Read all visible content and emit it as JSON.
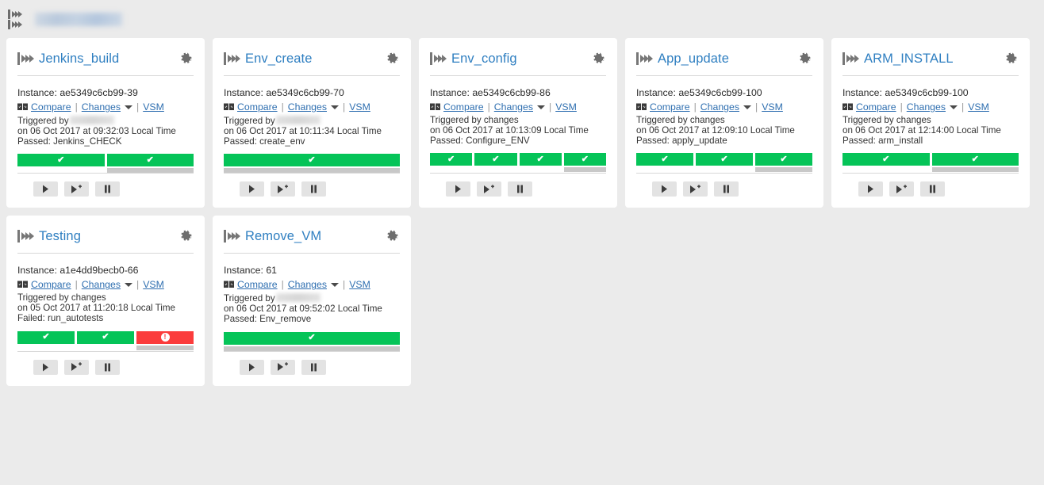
{
  "topbar": {
    "logo_icon": "pipeline-logo-icon",
    "title_redacted": "XXXXXXXXXXXX"
  },
  "labels": {
    "instance_prefix": "Instance: ",
    "compare": "Compare",
    "changes": "Changes",
    "vsm": "VSM",
    "separator": "|",
    "play_icon": "play-icon",
    "play_with_options_icon": "play-with-options-icon",
    "pause_icon": "pause-icon",
    "gear_icon": "gear-icon",
    "compare_icon": "compare-icon",
    "pipeline_icon": "pipeline-icon",
    "caret_icon": "chevron-down-icon",
    "pass_icon": "check-icon",
    "fail_icon": "alert-icon"
  },
  "colors": {
    "pass": "#05c458",
    "fail": "#fb3c3c",
    "idle": "#c8c8c8",
    "link": "#2f6fb0",
    "title": "#2f7fc1",
    "page_bg": "#ebebeb",
    "card_bg": "#ffffff"
  },
  "pipelines": [
    {
      "name": "Jenkins_build",
      "instance": "Instance: ae5349c6cb99-39",
      "trigger_line1_prefix": "Triggered by",
      "trigger_redacted": "XXXXXXX",
      "trigger_line2": "on 06 Oct 2017 at 09:32:03 Local Time",
      "status_line": "Passed: Jenkins_CHECK",
      "result": "Passed",
      "stages": [
        {
          "status": "pass",
          "sub": false
        },
        {
          "status": "pass",
          "sub": true
        }
      ]
    },
    {
      "name": "Env_create",
      "instance": "Instance: ae5349c6cb99-70",
      "trigger_line1_prefix": "Triggered by",
      "trigger_redacted": "XXXXXXX",
      "trigger_line2": "on 06 Oct 2017 at 10:11:34 Local Time",
      "status_line": "Passed: create_env",
      "result": "Passed",
      "stages": [
        {
          "status": "pass",
          "sub": true
        }
      ]
    },
    {
      "name": "Env_config",
      "instance": "Instance: ae5349c6cb99-86",
      "trigger_line1_prefix": "Triggered by changes",
      "trigger_redacted": "",
      "trigger_line2": "on 06 Oct 2017 at 10:13:09 Local Time",
      "status_line": "Passed: Configure_ENV",
      "result": "Passed",
      "stages": [
        {
          "status": "pass",
          "sub": false
        },
        {
          "status": "pass",
          "sub": false
        },
        {
          "status": "pass",
          "sub": false
        },
        {
          "status": "pass",
          "sub": true
        }
      ]
    },
    {
      "name": "App_update",
      "instance": "Instance: ae5349c6cb99-100",
      "trigger_line1_prefix": "Triggered by changes",
      "trigger_redacted": "",
      "trigger_line2": "on 06 Oct 2017 at 12:09:10 Local Time",
      "status_line": "Passed: apply_update",
      "result": "Passed",
      "stages": [
        {
          "status": "pass",
          "sub": false
        },
        {
          "status": "pass",
          "sub": false
        },
        {
          "status": "pass",
          "sub": true
        }
      ]
    },
    {
      "name": "ARM_INSTALL",
      "instance": "Instance: ae5349c6cb99-100",
      "trigger_line1_prefix": "Triggered by changes",
      "trigger_redacted": "",
      "trigger_line2": "on 06 Oct 2017 at 12:14:00 Local Time",
      "status_line": "Passed: arm_install",
      "result": "Passed",
      "stages": [
        {
          "status": "pass",
          "sub": false
        },
        {
          "status": "pass",
          "sub": true
        }
      ]
    },
    {
      "name": "Testing",
      "instance": "Instance: a1e4dd9becb0-66",
      "trigger_line1_prefix": "Triggered by changes",
      "trigger_redacted": "",
      "trigger_line2": "on 05 Oct 2017 at 11:20:18 Local Time",
      "status_line": "Failed: run_autotests",
      "result": "Failed",
      "stages": [
        {
          "status": "pass",
          "sub": false
        },
        {
          "status": "pass",
          "sub": false
        },
        {
          "status": "fail",
          "sub": true
        }
      ]
    },
    {
      "name": "Remove_VM",
      "instance": "Instance: 61",
      "trigger_line1_prefix": "Triggered by",
      "trigger_redacted": "XXXXXXX",
      "trigger_line2": "on 06 Oct 2017 at 09:52:02 Local Time",
      "status_line": "Passed: Env_remove",
      "result": "Passed",
      "stages": [
        {
          "status": "pass",
          "sub": true
        }
      ]
    }
  ]
}
